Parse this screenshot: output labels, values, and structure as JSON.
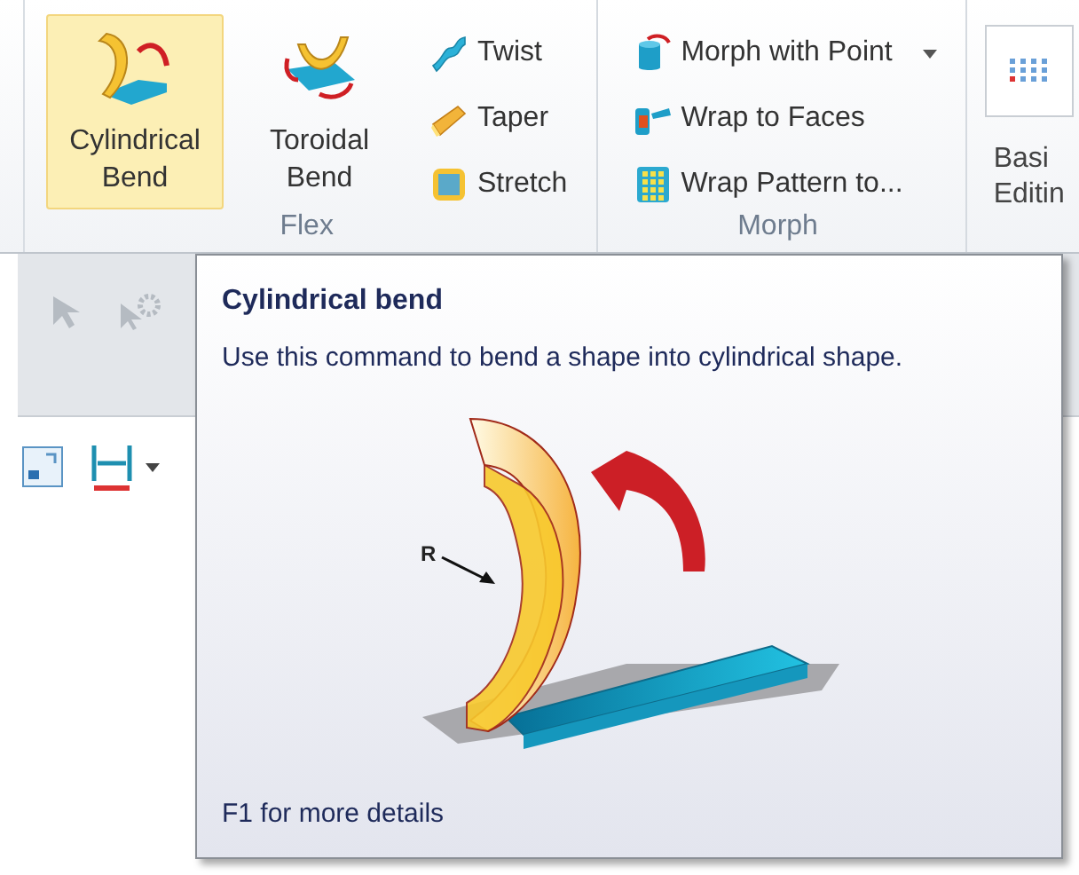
{
  "ribbon": {
    "groups": [
      {
        "label": "Flex",
        "large_buttons": [
          {
            "label": "Cylindrical Bend",
            "selected": true
          },
          {
            "label": "Toroidal Bend",
            "selected": false
          }
        ],
        "small_buttons": [
          {
            "label": "Twist",
            "dropdown": false
          },
          {
            "label": "Taper",
            "dropdown": false
          },
          {
            "label": "Stretch",
            "dropdown": false
          }
        ]
      },
      {
        "label": "Morph",
        "small_buttons": [
          {
            "label": "Morph with Point",
            "dropdown": true
          },
          {
            "label": "Wrap to Faces",
            "dropdown": false
          },
          {
            "label": "Wrap Pattern to...",
            "dropdown": false
          }
        ]
      }
    ],
    "partial_group": {
      "label_lines": [
        "Basi",
        "Editin"
      ]
    }
  },
  "tooltip": {
    "title": "Cylindrical bend",
    "description": "Use this command to bend a shape into cylindrical shape.",
    "diagram_label": "R",
    "footer": "F1 for more details"
  }
}
